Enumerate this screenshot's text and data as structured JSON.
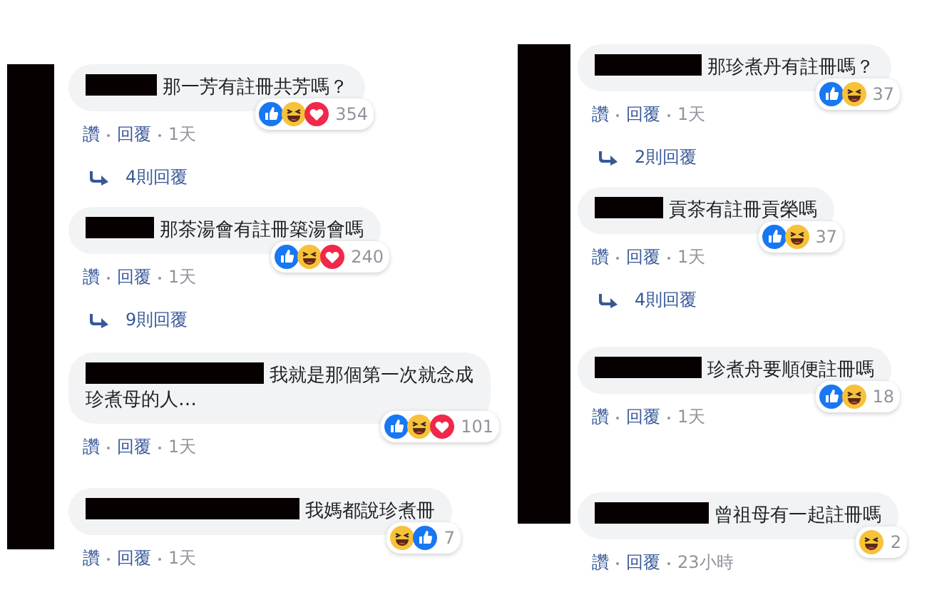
{
  "columns": [
    {
      "comments": [
        {
          "name_redacted": true,
          "text": "那一芳有註冊共芳嗎？",
          "reactions": [
            {
              "kind": "like"
            },
            {
              "kind": "haha"
            },
            {
              "kind": "love"
            }
          ],
          "count": "354",
          "actions": [
            "讚",
            "回覆"
          ],
          "time": "1天",
          "replies": "4則回覆"
        },
        {
          "name_redacted": true,
          "text": "那茶湯會有註冊築湯會嗎",
          "reactions": [
            {
              "kind": "like"
            },
            {
              "kind": "haha"
            },
            {
              "kind": "love"
            }
          ],
          "count": "240",
          "actions": [
            "讚",
            "回覆"
          ],
          "time": "1天",
          "replies": "9則回覆"
        },
        {
          "name_redacted": true,
          "text": "我就是那個第一次就念成珍煮母的人…",
          "reactions": [
            {
              "kind": "like"
            },
            {
              "kind": "haha"
            },
            {
              "kind": "love"
            }
          ],
          "count": "101",
          "actions": [
            "讚",
            "回覆"
          ],
          "time": "1天"
        },
        {
          "name_redacted": true,
          "text": "我媽都說珍煮冊",
          "reactions": [
            {
              "kind": "haha"
            },
            {
              "kind": "like"
            }
          ],
          "count": "7",
          "actions": [
            "讚",
            "回覆"
          ],
          "time": "1天"
        }
      ]
    },
    {
      "comments": [
        {
          "name_redacted": true,
          "text": "那珍煮丹有註冊嗎？",
          "reactions": [
            {
              "kind": "like"
            },
            {
              "kind": "haha"
            }
          ],
          "count": "37",
          "actions": [
            "讚",
            "回覆"
          ],
          "time": "1天",
          "replies": "2則回覆"
        },
        {
          "name_redacted": true,
          "text": "貢茶有註冊貢榮嗎",
          "reactions": [
            {
              "kind": "like"
            },
            {
              "kind": "haha"
            }
          ],
          "count": "37",
          "actions": [
            "讚",
            "回覆"
          ],
          "time": "1天",
          "replies": "4則回覆"
        },
        {
          "name_redacted": true,
          "text": "珍煮舟要順便註冊嗎",
          "reactions": [
            {
              "kind": "like"
            },
            {
              "kind": "haha"
            }
          ],
          "count": "18",
          "actions": [
            "讚",
            "回覆"
          ],
          "time": "1天"
        },
        {
          "name_redacted": true,
          "text": "曾祖母有一起註冊嗎",
          "reactions": [
            {
              "kind": "haha"
            }
          ],
          "count": "2",
          "actions": [
            "讚",
            "回覆"
          ],
          "time": "23小時"
        }
      ]
    }
  ]
}
